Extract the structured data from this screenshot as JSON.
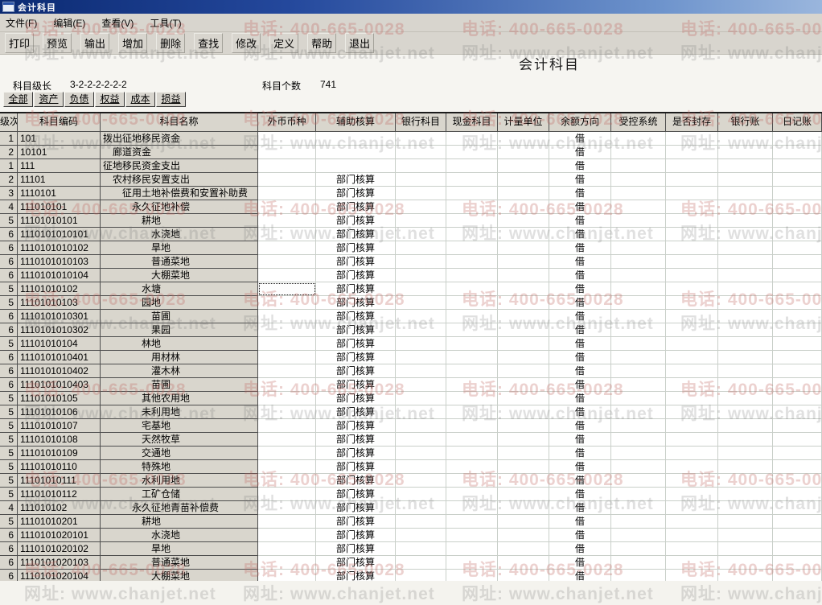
{
  "window": {
    "title": "会计科目"
  },
  "menu": {
    "items": [
      "文件(F)",
      "编辑(E)",
      "查看(V)",
      "工具(T)"
    ]
  },
  "toolbar": {
    "buttons": [
      "打印",
      "预览",
      "输出",
      "增加",
      "删除",
      "查找",
      "修改",
      "定义",
      "帮助",
      "退出"
    ]
  },
  "report": {
    "title": "会计科目",
    "level_label": "科目级长",
    "level_value": "3-2-2-2-2-2-2",
    "count_label": "科目个数",
    "count_value": "741"
  },
  "tabs": [
    "全部",
    "资产",
    "负债",
    "权益",
    "成本",
    "损益"
  ],
  "table": {
    "columns": [
      "级次",
      "科目编码",
      "科目名称",
      "外币币种",
      "辅助核算",
      "银行科目",
      "现金科目",
      "计量单位",
      "余额方向",
      "受控系统",
      "是否封存",
      "银行账",
      "日记账"
    ],
    "rows": [
      {
        "level": "1",
        "code": "101",
        "name": "拨出征地移民资金",
        "aux": "",
        "dir": "借"
      },
      {
        "level": "2",
        "code": "10101",
        "name": "廊道资金",
        "aux": "",
        "dir": "借"
      },
      {
        "level": "1",
        "code": "111",
        "name": "征地移民资金支出",
        "aux": "",
        "dir": "借"
      },
      {
        "level": "2",
        "code": "11101",
        "name": "农村移民安置支出",
        "aux": "部门核算",
        "dir": "借"
      },
      {
        "level": "3",
        "code": "1110101",
        "name": "征用土地补偿费和安置补助费",
        "aux": "部门核算",
        "dir": "借"
      },
      {
        "level": "4",
        "code": "111010101",
        "name": "永久征地补偿",
        "aux": "部门核算",
        "dir": "借"
      },
      {
        "level": "5",
        "code": "11101010101",
        "name": "耕地",
        "aux": "部门核算",
        "dir": "借"
      },
      {
        "level": "6",
        "code": "1110101010101",
        "name": "水浇地",
        "aux": "部门核算",
        "dir": "借"
      },
      {
        "level": "6",
        "code": "1110101010102",
        "name": "旱地",
        "aux": "部门核算",
        "dir": "借"
      },
      {
        "level": "6",
        "code": "1110101010103",
        "name": "普通菜地",
        "aux": "部门核算",
        "dir": "借"
      },
      {
        "level": "6",
        "code": "1110101010104",
        "name": "大棚菜地",
        "aux": "部门核算",
        "dir": "借"
      },
      {
        "level": "5",
        "code": "11101010102",
        "name": "水塘",
        "aux": "部门核算",
        "dir": "借"
      },
      {
        "level": "5",
        "code": "11101010103",
        "name": "园地",
        "aux": "部门核算",
        "dir": "借"
      },
      {
        "level": "6",
        "code": "1110101010301",
        "name": "苗圃",
        "aux": "部门核算",
        "dir": "借"
      },
      {
        "level": "6",
        "code": "1110101010302",
        "name": "果园",
        "aux": "部门核算",
        "dir": "借"
      },
      {
        "level": "5",
        "code": "11101010104",
        "name": "林地",
        "aux": "部门核算",
        "dir": "借"
      },
      {
        "level": "6",
        "code": "1110101010401",
        "name": "用材林",
        "aux": "部门核算",
        "dir": "借"
      },
      {
        "level": "6",
        "code": "1110101010402",
        "name": "灌木林",
        "aux": "部门核算",
        "dir": "借"
      },
      {
        "level": "6",
        "code": "1110101010403",
        "name": "苗圃",
        "aux": "部门核算",
        "dir": "借"
      },
      {
        "level": "5",
        "code": "11101010105",
        "name": "其他农用地",
        "aux": "部门核算",
        "dir": "借"
      },
      {
        "level": "5",
        "code": "11101010106",
        "name": "未利用地",
        "aux": "部门核算",
        "dir": "借"
      },
      {
        "level": "5",
        "code": "11101010107",
        "name": "宅基地",
        "aux": "部门核算",
        "dir": "借"
      },
      {
        "level": "5",
        "code": "11101010108",
        "name": "天然牧草",
        "aux": "部门核算",
        "dir": "借"
      },
      {
        "level": "5",
        "code": "11101010109",
        "name": "交通地",
        "aux": "部门核算",
        "dir": "借"
      },
      {
        "level": "5",
        "code": "11101010110",
        "name": "特殊地",
        "aux": "部门核算",
        "dir": "借"
      },
      {
        "level": "5",
        "code": "11101010111",
        "name": "水利用地",
        "aux": "部门核算",
        "dir": "借"
      },
      {
        "level": "5",
        "code": "11101010112",
        "name": "工矿仓储",
        "aux": "部门核算",
        "dir": "借"
      },
      {
        "level": "4",
        "code": "111010102",
        "name": "永久征地青苗补偿费",
        "aux": "部门核算",
        "dir": "借"
      },
      {
        "level": "5",
        "code": "11101010201",
        "name": "耕地",
        "aux": "部门核算",
        "dir": "借"
      },
      {
        "level": "6",
        "code": "1110101020101",
        "name": "水浇地",
        "aux": "部门核算",
        "dir": "借"
      },
      {
        "level": "6",
        "code": "1110101020102",
        "name": "旱地",
        "aux": "部门核算",
        "dir": "借"
      },
      {
        "level": "6",
        "code": "1110101020103",
        "name": "普通菜地",
        "aux": "部门核算",
        "dir": "借"
      },
      {
        "level": "6",
        "code": "1110101020104",
        "name": "大棚菜地",
        "aux": "部门核算",
        "dir": "借"
      }
    ]
  },
  "selection": {
    "row_index": 11,
    "column_label": "外币币种"
  },
  "watermark": {
    "phone_text": "电话: 400-665-0028",
    "url_text": "网址: www.chanjet.net",
    "phone_color": "rgba(193,103,97,0.30)",
    "url_color": "rgba(112,112,112,0.22)"
  }
}
